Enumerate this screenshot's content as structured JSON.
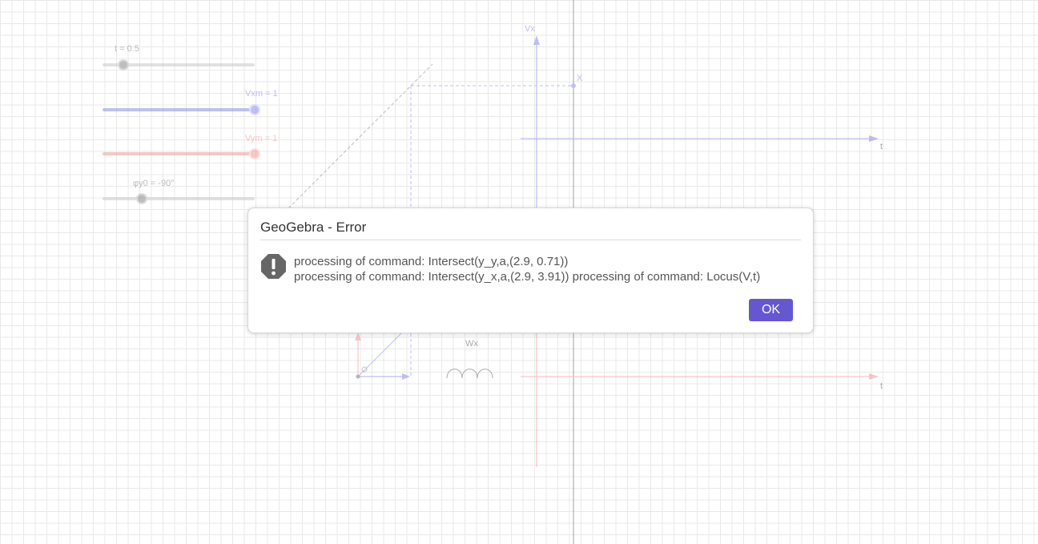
{
  "colors": {
    "blue": "#8c8cf0",
    "red": "#f09a9a",
    "gray": "#9b9b9b",
    "grid": "#e9e9e9",
    "accent": "#6557d2"
  },
  "sliders": [
    {
      "name": "t",
      "label": "t = 0.5",
      "value": 0.5,
      "min": 0,
      "max": 1,
      "color": "#9b9b9b"
    },
    {
      "name": "Vxm",
      "label": "Vxm = 1",
      "value": 1,
      "min": -1,
      "max": 1,
      "color": "#8c8cf0"
    },
    {
      "name": "Vym",
      "label": "Vym = 1",
      "value": 1,
      "min": -1,
      "max": 1,
      "color": "#f09a9a"
    },
    {
      "name": "phi_y0",
      "label": "φy0 = -90°",
      "value": -90,
      "min": -180,
      "max": 180,
      "color": "#9b9b9b"
    }
  ],
  "graph_labels": {
    "vx_axis": "Vx",
    "t_axis_top": "t",
    "t_axis_bottom": "t",
    "point_x": "X",
    "wx": "Wx"
  },
  "dialog": {
    "title": "GeoGebra - Error",
    "message_line1": "processing of command: Intersect(y_y,a,(2.9, 0.71))",
    "message_line2": "processing of command: Intersect(y_x,a,(2.9, 3.91)) processing of command: Locus(V,t)",
    "ok_label": "OK",
    "icon": "exclamation-icon"
  }
}
